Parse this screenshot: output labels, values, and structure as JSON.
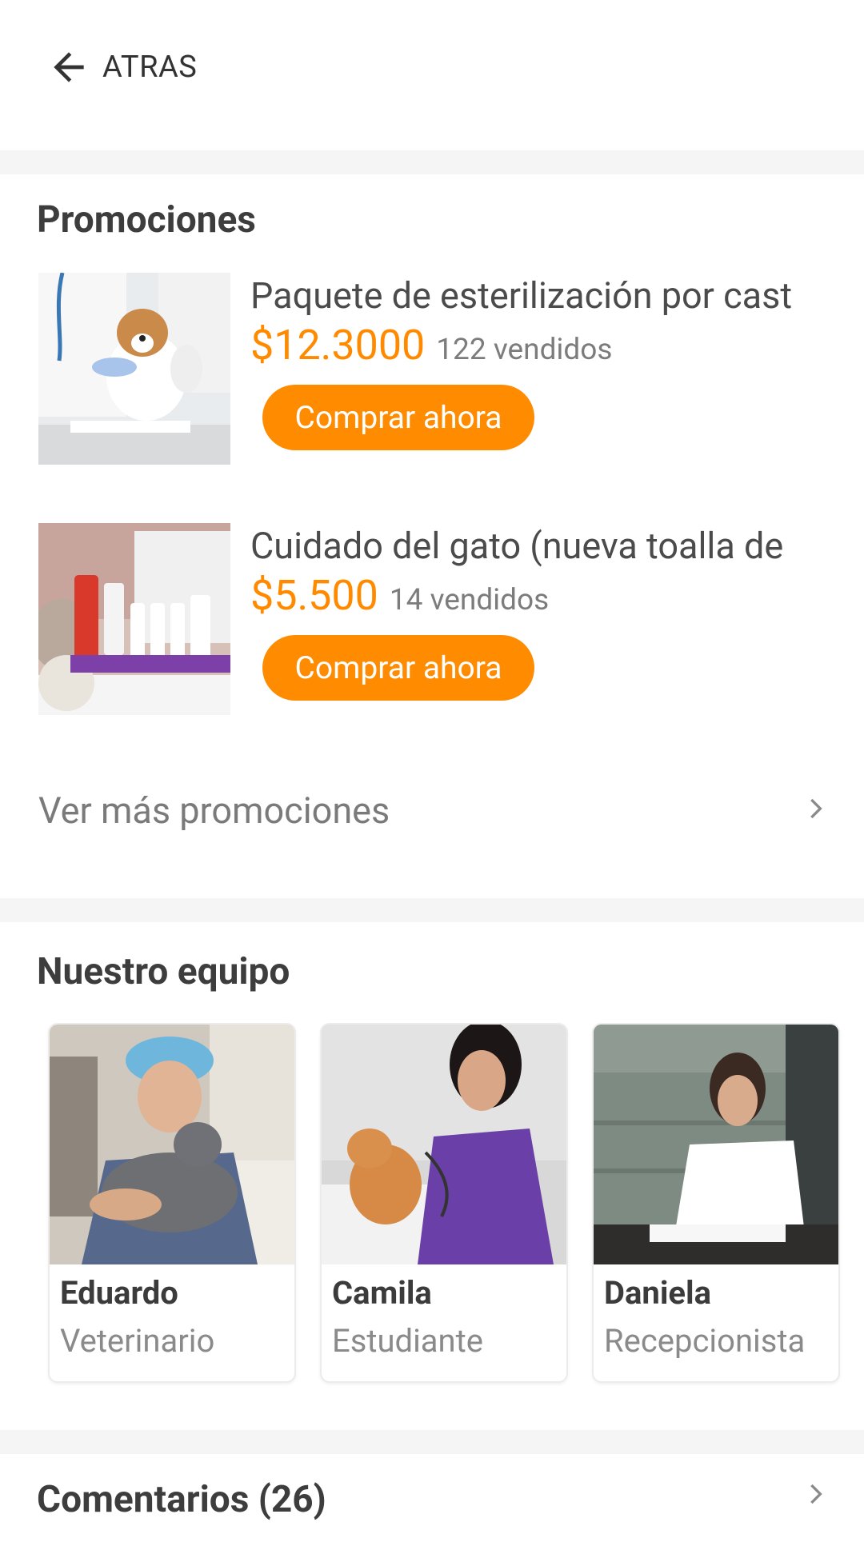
{
  "header": {
    "back_label": "ATRAS"
  },
  "promotions": {
    "title": "Promociones",
    "items": [
      {
        "title": "Paquete de esterilización por cast",
        "price": "$12.3000",
        "sold": "122 vendidos",
        "button": "Comprar ahora"
      },
      {
        "title": "Cuidado del gato (nueva toalla de",
        "price": "$5.500",
        "sold": "14 vendidos",
        "button": "Comprar ahora"
      }
    ],
    "more_label": "Ver más promociones"
  },
  "team": {
    "title": "Nuestro equipo",
    "members": [
      {
        "name": "Eduardo",
        "role": "Veterinario"
      },
      {
        "name": "Camila",
        "role": "Estudiante"
      },
      {
        "name": "Daniela",
        "role": "Recepcionista"
      }
    ]
  },
  "comments": {
    "title": "Comentarios (26)"
  },
  "colors": {
    "accent": "#ff8c00",
    "divider": "#f5f5f5"
  }
}
